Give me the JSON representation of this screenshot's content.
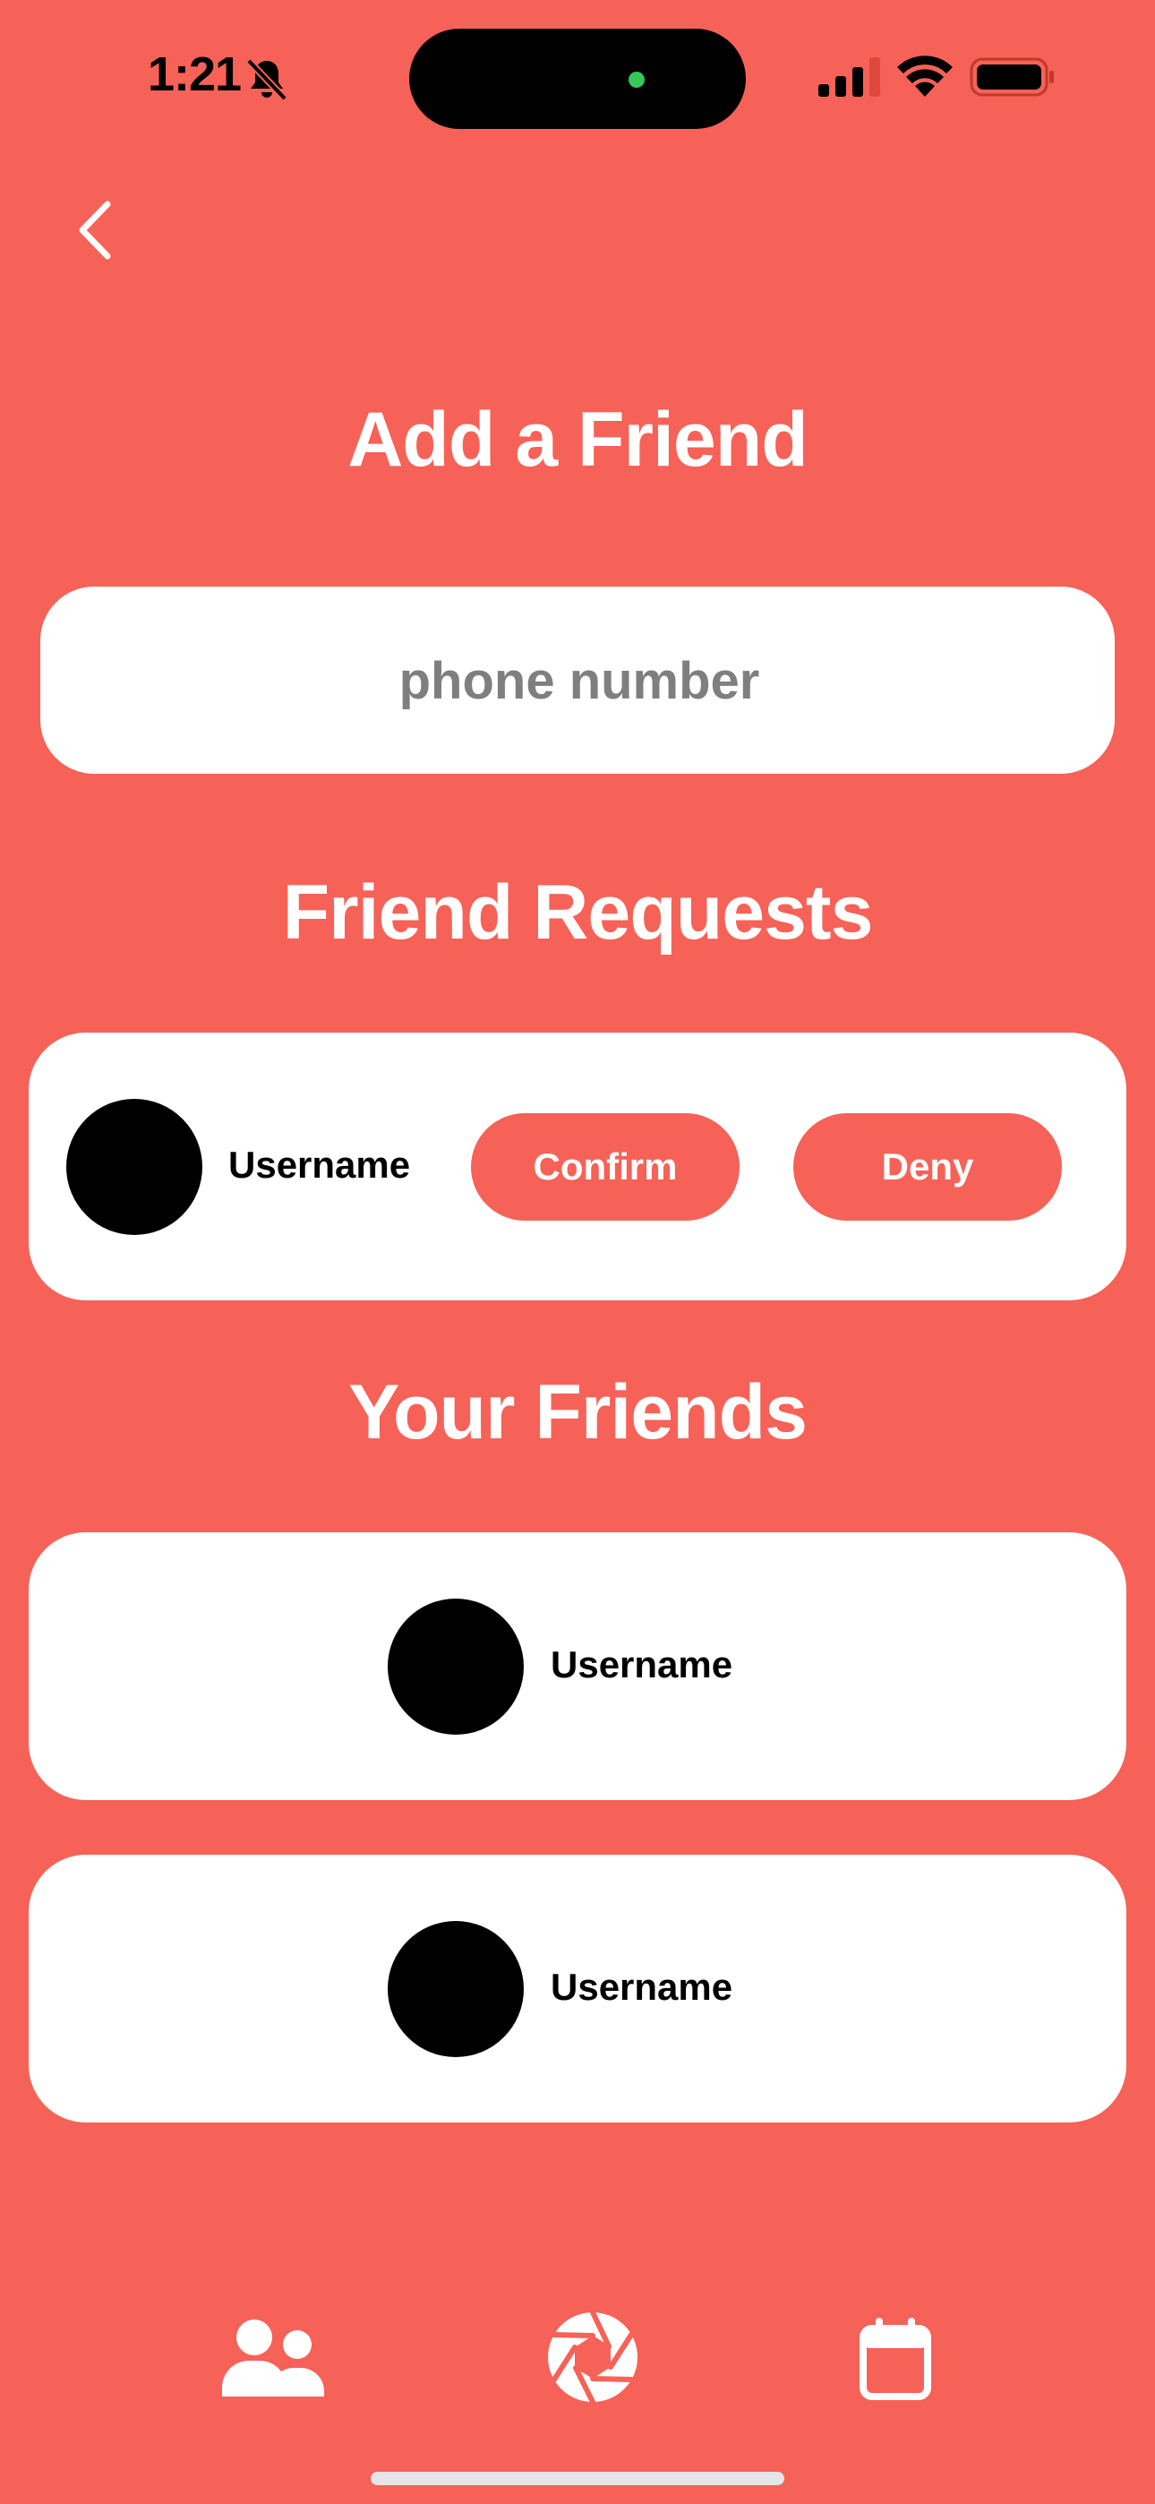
{
  "status_bar": {
    "time": "1:21",
    "icons": [
      "bell-slash-icon",
      "cellular-signal-icon",
      "wifi-icon",
      "battery-icon"
    ]
  },
  "nav": {
    "back_icon": "chevron-left-icon"
  },
  "add_friend": {
    "title": "Add a Friend",
    "placeholder": "phone number",
    "value": ""
  },
  "friend_requests": {
    "title": "Friend Requests",
    "items": [
      {
        "username": "Username",
        "confirm_label": "Confirm",
        "deny_label": "Deny"
      }
    ]
  },
  "your_friends": {
    "title": "Your Friends",
    "items": [
      {
        "username": "Username"
      },
      {
        "username": "Username"
      }
    ]
  },
  "tab_bar": {
    "tabs": [
      {
        "name": "friends",
        "icon": "people-icon"
      },
      {
        "name": "camera",
        "icon": "aperture-icon"
      },
      {
        "name": "calendar",
        "icon": "calendar-icon"
      }
    ]
  },
  "colors": {
    "background": "#F66257",
    "card": "#FFFFFF",
    "accent_button": "#F66257",
    "text_dark": "#000000",
    "placeholder": "#7F7F7F"
  }
}
